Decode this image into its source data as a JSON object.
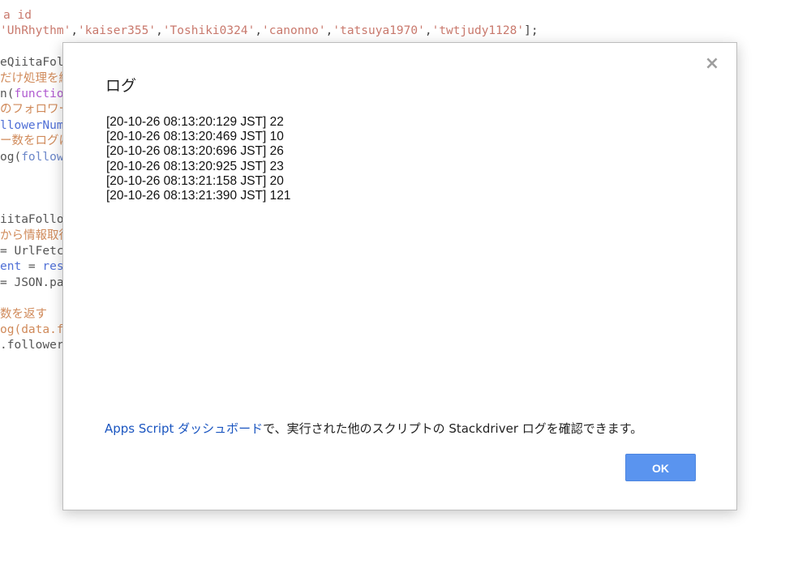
{
  "editor": {
    "lines": [
      {
        "segments": [
          {
            "cls": "c-str",
            "text": "a id"
          }
        ]
      },
      {
        "segments": [
          {
            "cls": "c-str",
            "text": "'UhRhythm'"
          },
          {
            "cls": "c-punct",
            "text": ","
          },
          {
            "cls": "c-str",
            "text": "'kaiser355'"
          },
          {
            "cls": "c-punct",
            "text": ","
          },
          {
            "cls": "c-str",
            "text": "'Toshiki0324'"
          },
          {
            "cls": "c-punct",
            "text": ","
          },
          {
            "cls": "c-str",
            "text": "'canonno'"
          },
          {
            "cls": "c-punct",
            "text": ","
          },
          {
            "cls": "c-str",
            "text": "'tatsuya1970'"
          },
          {
            "cls": "c-punct",
            "text": ","
          },
          {
            "cls": "c-str",
            "text": "'twtjudy1128'"
          },
          {
            "cls": "c-punct",
            "text": "];"
          }
        ]
      },
      {
        "segments": []
      },
      {
        "segments": [
          {
            "cls": "c-plain",
            "text": "eQiitaFol"
          }
        ]
      },
      {
        "segments": [
          {
            "cls": "c-comment",
            "text": "だけ処理を繰"
          }
        ]
      },
      {
        "segments": [
          {
            "cls": "c-plain",
            "text": "n("
          },
          {
            "cls": "c-kw",
            "text": "function"
          }
        ]
      },
      {
        "segments": [
          {
            "cls": "c-comment",
            "text": "のフォロワー数"
          }
        ]
      },
      {
        "segments": [
          {
            "cls": "c-var",
            "text": "llowerNum"
          }
        ]
      },
      {
        "segments": [
          {
            "cls": "c-comment",
            "text": "ー数をログに"
          }
        ]
      },
      {
        "segments": [
          {
            "cls": "c-plain",
            "text": "og("
          },
          {
            "cls": "c-blue",
            "text": "follow"
          }
        ]
      },
      {
        "segments": []
      },
      {
        "segments": []
      },
      {
        "segments": []
      },
      {
        "segments": [
          {
            "cls": "c-plain",
            "text": "iitaFollo"
          }
        ]
      },
      {
        "segments": [
          {
            "cls": "c-comment",
            "text": "から情報取得"
          }
        ]
      },
      {
        "segments": [
          {
            "cls": "c-plain",
            "text": "= UrlFetch"
          }
        ]
      },
      {
        "segments": [
          {
            "cls": "c-var",
            "text": "ent"
          },
          {
            "cls": "c-plain",
            "text": " = "
          },
          {
            "cls": "c-var",
            "text": "res."
          }
        ]
      },
      {
        "segments": [
          {
            "cls": "c-plain",
            "text": "= JSON.pa"
          }
        ]
      },
      {
        "segments": []
      },
      {
        "segments": [
          {
            "cls": "c-comment",
            "text": "数を返す"
          }
        ]
      },
      {
        "segments": [
          {
            "cls": "c-comment",
            "text": "og(data.f"
          }
        ]
      },
      {
        "segments": [
          {
            "cls": "c-plain",
            "text": ".follower"
          }
        ]
      }
    ]
  },
  "dialog": {
    "title": "ログ",
    "close_label": "×",
    "log_lines": [
      "[20-10-26 08:13:20:129 JST] 22",
      "[20-10-26 08:13:20:469 JST] 10",
      "[20-10-26 08:13:20:696 JST] 26",
      "[20-10-26 08:13:20:925 JST] 23",
      "[20-10-26 08:13:21:158 JST] 20",
      "[20-10-26 08:13:21:390 JST] 121"
    ],
    "footer_link": "Apps Script ダッシュボード",
    "footer_text": "で、実行された他のスクリプトの Stackdriver ログを確認できます。",
    "ok_label": "OK"
  }
}
